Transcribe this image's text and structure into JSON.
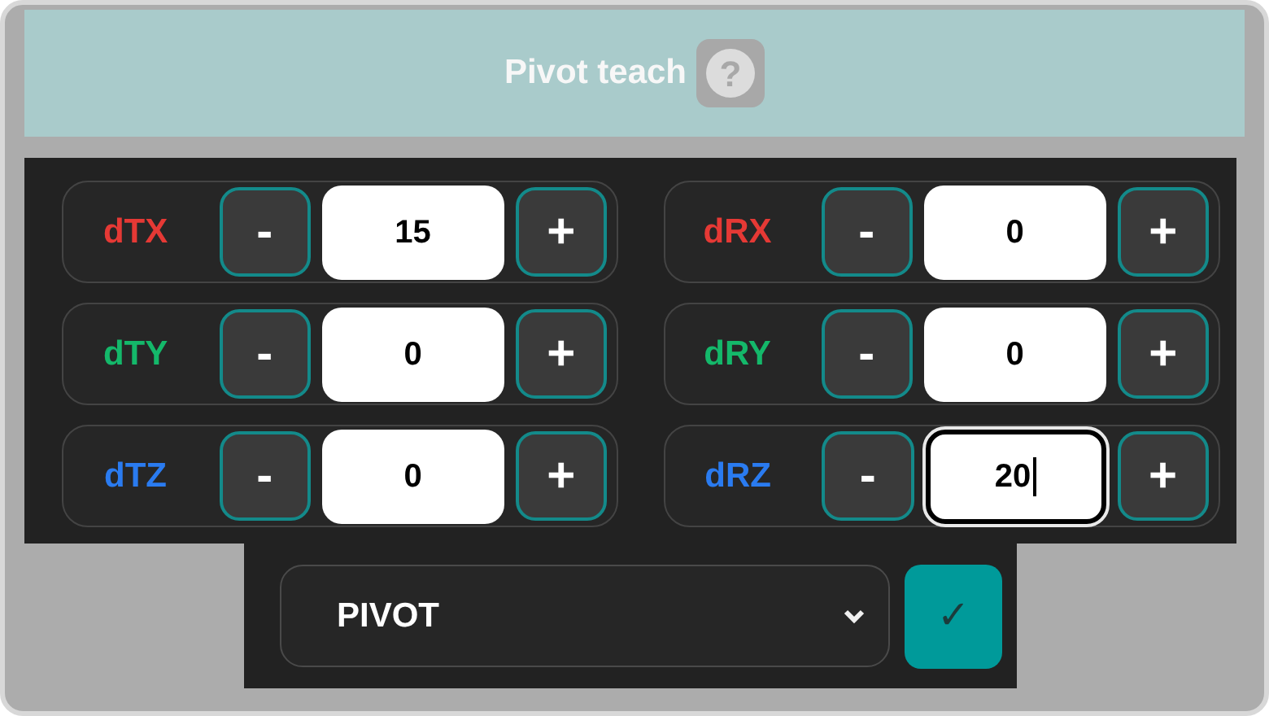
{
  "header": {
    "title": "Pivot teach",
    "help": "?"
  },
  "axes": [
    {
      "label": "dTX",
      "color": "#e53935",
      "minus": "-",
      "value": "15",
      "plus": "+",
      "focused": false
    },
    {
      "label": "dRX",
      "color": "#e53935",
      "minus": "-",
      "value": "0",
      "plus": "+",
      "focused": false
    },
    {
      "label": "dTY",
      "color": "#14b86a",
      "minus": "-",
      "value": "0",
      "plus": "+",
      "focused": false
    },
    {
      "label": "dRY",
      "color": "#14b86a",
      "minus": "-",
      "value": "0",
      "plus": "+",
      "focused": false
    },
    {
      "label": "dTZ",
      "color": "#2a7bf0",
      "minus": "-",
      "value": "0",
      "plus": "+",
      "focused": false
    },
    {
      "label": "dRZ",
      "color": "#2a7bf0",
      "minus": "-",
      "value": "20",
      "plus": "+",
      "focused": true
    }
  ],
  "mode_select": {
    "value": "PIVOT"
  },
  "confirm": "✓"
}
